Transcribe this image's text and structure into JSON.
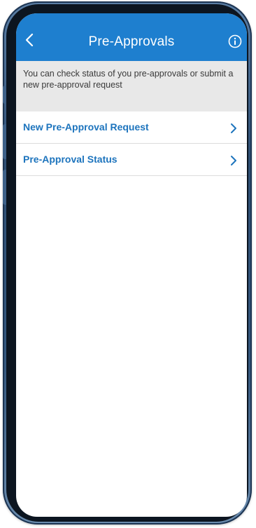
{
  "header": {
    "title": "Pre-Approvals",
    "back_icon": "chevron-left-icon",
    "info_icon": "info-circle-icon"
  },
  "banner": {
    "text": "You can check status of you pre-approvals or submit a new pre-approval request"
  },
  "menu": {
    "items": [
      {
        "label": "New Pre-Approval Request",
        "icon": "chevron-right-icon"
      },
      {
        "label": "Pre-Approval Status",
        "icon": "chevron-right-icon"
      }
    ]
  },
  "colors": {
    "header_background": "#1e7fcf",
    "banner_background": "#e8e8e8",
    "link_text": "#1d74bd",
    "phone_frame": "#35587e"
  }
}
